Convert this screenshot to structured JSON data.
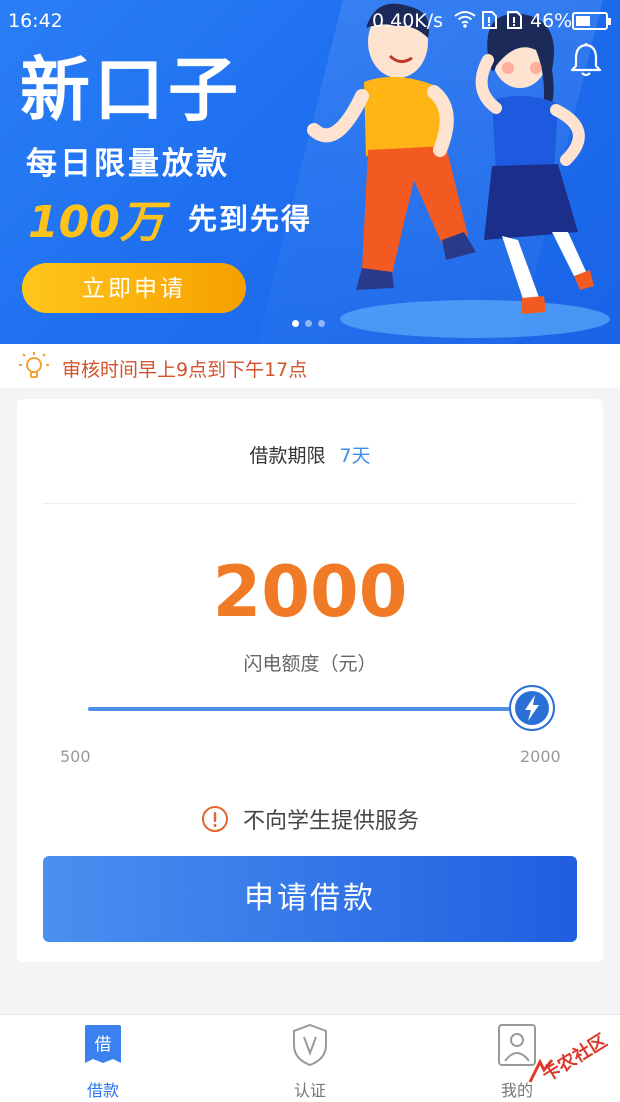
{
  "status_bar": {
    "time": "16:42",
    "network_speed": "0.40K/s",
    "battery": "46%"
  },
  "banner": {
    "title": "新口子",
    "subtitle": "每日限量放款",
    "amount": "100万",
    "first_come": "先到先得",
    "apply_now": "立即申请",
    "slide_count": 3,
    "active_slide": 1
  },
  "notice": {
    "text": "审核时间早上9点到下午17点"
  },
  "loan": {
    "term_label": "借款期限",
    "term_value": "7天",
    "amount": "2000",
    "amount_label": "闪电额度（元）",
    "slider_min": "500",
    "slider_max": "2000",
    "slider_value_fraction": 1.0,
    "warning": "不向学生提供服务",
    "apply_button": "申请借款"
  },
  "nav": {
    "items": [
      {
        "label": "借款",
        "icon": "borrow-icon",
        "active": true
      },
      {
        "label": "认证",
        "icon": "shield-v-icon",
        "active": false
      },
      {
        "label": "我的",
        "icon": "user-icon",
        "active": false
      }
    ]
  },
  "watermark": {
    "text": "卡农社区"
  },
  "colors": {
    "banner_blue": "#1e6ff0",
    "accent_orange": "#f07a26",
    "link_blue": "#3e8ee8",
    "notice_red": "#d2542a",
    "button_blue_start": "#4a90f0",
    "button_blue_end": "#1f5fe0"
  }
}
